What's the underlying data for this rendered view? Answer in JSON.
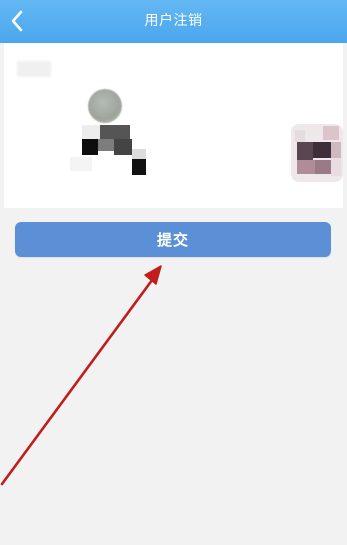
{
  "header": {
    "title": "用户注销",
    "back_icon": "chevron-left-icon"
  },
  "actions": {
    "submit_label": "提交"
  },
  "colors": {
    "header_bg": "#4aa6ec",
    "submit_bg": "#5b8fd6",
    "page_bg": "#f2f2f2",
    "annotation_arrow": "#c21d1d"
  }
}
